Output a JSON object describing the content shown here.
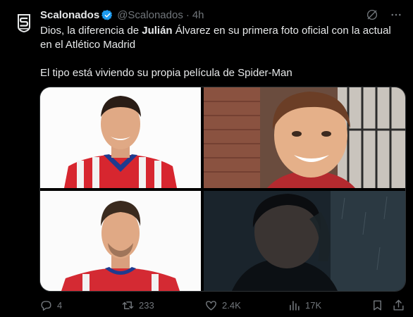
{
  "tweet": {
    "author_name": "Scalonados",
    "handle": "@Scalonados",
    "separator": "·",
    "time": "4h",
    "text_line1_pre": "Dios, la diferencia de ",
    "text_line1_bold": "Julián",
    "text_line1_post": " Álvarez en su primera foto oficial con la actual en el Atlético Madrid",
    "text_line2": "El tipo está viviendo su propia película de Spider-Man"
  },
  "media": [
    {
      "icon": "photo-icon",
      "subject": "julian-alvarez-official-photo-red-white-stripes"
    },
    {
      "icon": "photo-icon",
      "subject": "spider-man-actor-smiling"
    },
    {
      "icon": "photo-icon",
      "subject": "julian-alvarez-atletico-photo"
    },
    {
      "icon": "photo-icon",
      "subject": "spider-man-actor-dark-rain"
    }
  ],
  "actions": {
    "replies": "4",
    "reposts": "233",
    "likes": "2.4K",
    "views": "17K"
  },
  "colors": {
    "background": "#000000",
    "text": "#e7e9ea",
    "muted": "#71767b",
    "verified": "#1d9bf0"
  }
}
